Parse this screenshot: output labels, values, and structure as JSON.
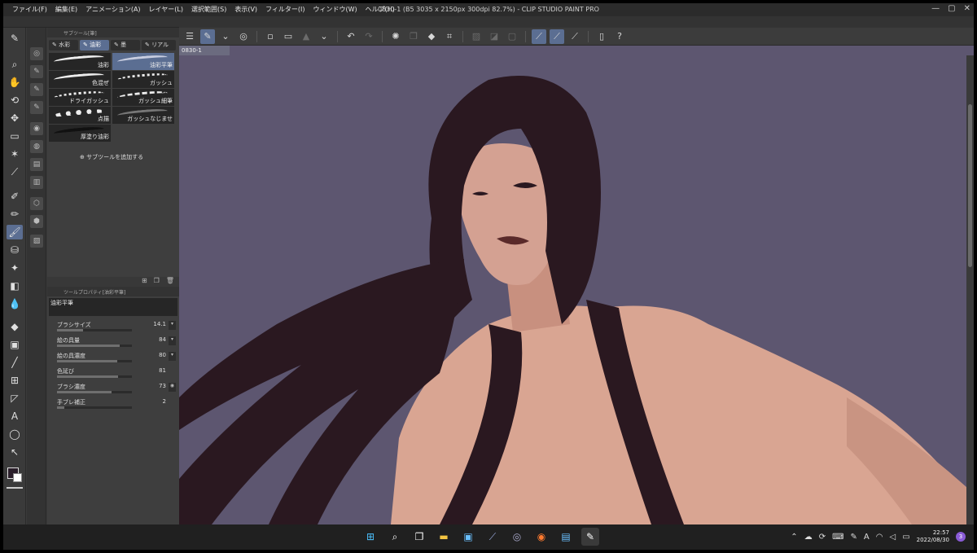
{
  "window": {
    "title": "0830-1 (B5 3035 x 2150px 300dpi 82.7%) - CLIP STUDIO PAINT PRO",
    "controls": [
      "—",
      "▢",
      "✕"
    ]
  },
  "menu": [
    "ファイル(F)",
    "編集(E)",
    "アニメーション(A)",
    "レイヤー(L)",
    "選択範囲(S)",
    "表示(V)",
    "フィルター(I)",
    "ウィンドウ(W)",
    "ヘルプ(H)"
  ],
  "document_tab": "0830-1",
  "subtool_panel": {
    "header": "サブツール[筆]",
    "tabs": [
      {
        "label": "水彩",
        "active": false
      },
      {
        "label": "油彩",
        "active": true
      },
      {
        "label": "墨",
        "active": false
      },
      {
        "label": "リアル",
        "active": false
      }
    ],
    "brushes": [
      {
        "label": "油彩",
        "active": false
      },
      {
        "label": "油彩平筆",
        "active": true
      },
      {
        "label": "色混ぜ",
        "active": false
      },
      {
        "label": "ガッシュ",
        "active": false
      },
      {
        "label": "ドライガッシュ",
        "active": false
      },
      {
        "label": "ガッシュ細筆",
        "active": false
      },
      {
        "label": "点描",
        "active": false
      },
      {
        "label": "ガッシュなじませ",
        "active": false
      },
      {
        "label": "厚塗り油彩",
        "active": false
      }
    ],
    "add_subtool": "サブツールを追加する"
  },
  "property_panel": {
    "header": "ツールプロパティ[油彩平筆]",
    "tool_name": "油彩平筆",
    "props": [
      {
        "label": "ブラシサイズ",
        "value": "14.1",
        "fill": 0.35
      },
      {
        "label": "絵の具量",
        "value": "84",
        "fill": 0.84
      },
      {
        "label": "絵の具濃度",
        "value": "80",
        "fill": 0.8
      },
      {
        "label": "色延び",
        "value": "81",
        "fill": 0.81
      },
      {
        "label": "ブラシ濃度",
        "value": "73",
        "fill": 0.73
      },
      {
        "label": "手ブレ補正",
        "value": "2",
        "fill": 0.1
      }
    ]
  },
  "colors": {
    "main_color": "#2a1e2a",
    "sub_color": "#ffffff",
    "canvas_bg": "#5d5670",
    "accent": "#5b6e92"
  },
  "taskbar": {
    "time": "22:57",
    "date": "2022/08/30",
    "notification_count": "3",
    "ime": "A"
  }
}
